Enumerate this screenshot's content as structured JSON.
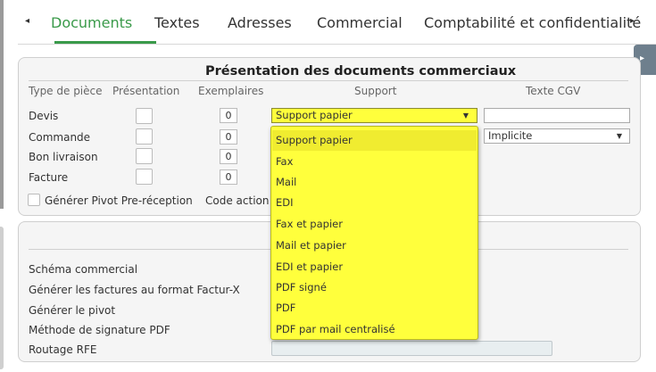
{
  "tabs": {
    "items": [
      {
        "label": "Documents",
        "active": true
      },
      {
        "label": "Textes",
        "active": false
      },
      {
        "label": "Adresses",
        "active": false
      },
      {
        "label": "Commercial",
        "active": false
      },
      {
        "label": "Comptabilité et confidentialité",
        "active": false
      }
    ],
    "prev_icon": "◂",
    "next_icon": "▸"
  },
  "side_handle_icon": "▸",
  "panel1": {
    "title": "Présentation des documents commerciaux",
    "columns": [
      "Type de pièce",
      "Présentation",
      "Exemplaires",
      "Support",
      "Texte CGV"
    ],
    "rows": [
      {
        "label": "Devis",
        "copies": "0"
      },
      {
        "label": "Commande",
        "copies": "0"
      },
      {
        "label": "Bon livraison",
        "copies": "0"
      },
      {
        "label": "Facture",
        "copies": "0"
      }
    ],
    "support_selected": "Support papier",
    "cgv_value": "Implicite",
    "pivot_label": "Générer Pivot Pre-réception",
    "code_action_label": "Code action"
  },
  "support_dropdown": {
    "options": [
      "Support papier",
      "Fax",
      "Mail",
      "EDI",
      "Fax et papier",
      "Mail et papier",
      "EDI et papier",
      "PDF signé",
      "PDF",
      "PDF par mail centralisé"
    ],
    "highlighted": "Support papier"
  },
  "panel2": {
    "labels": [
      "Schéma commercial",
      "Générer les factures au format Factur-X",
      "Générer le pivot",
      "Méthode de signature PDF",
      "Routage RFE"
    ]
  },
  "colors": {
    "accent": "#3a9a4a",
    "dropdown_bg": "#ffff3c",
    "panel_bg": "#f5f5f5",
    "handle": "#6e7f8d"
  }
}
